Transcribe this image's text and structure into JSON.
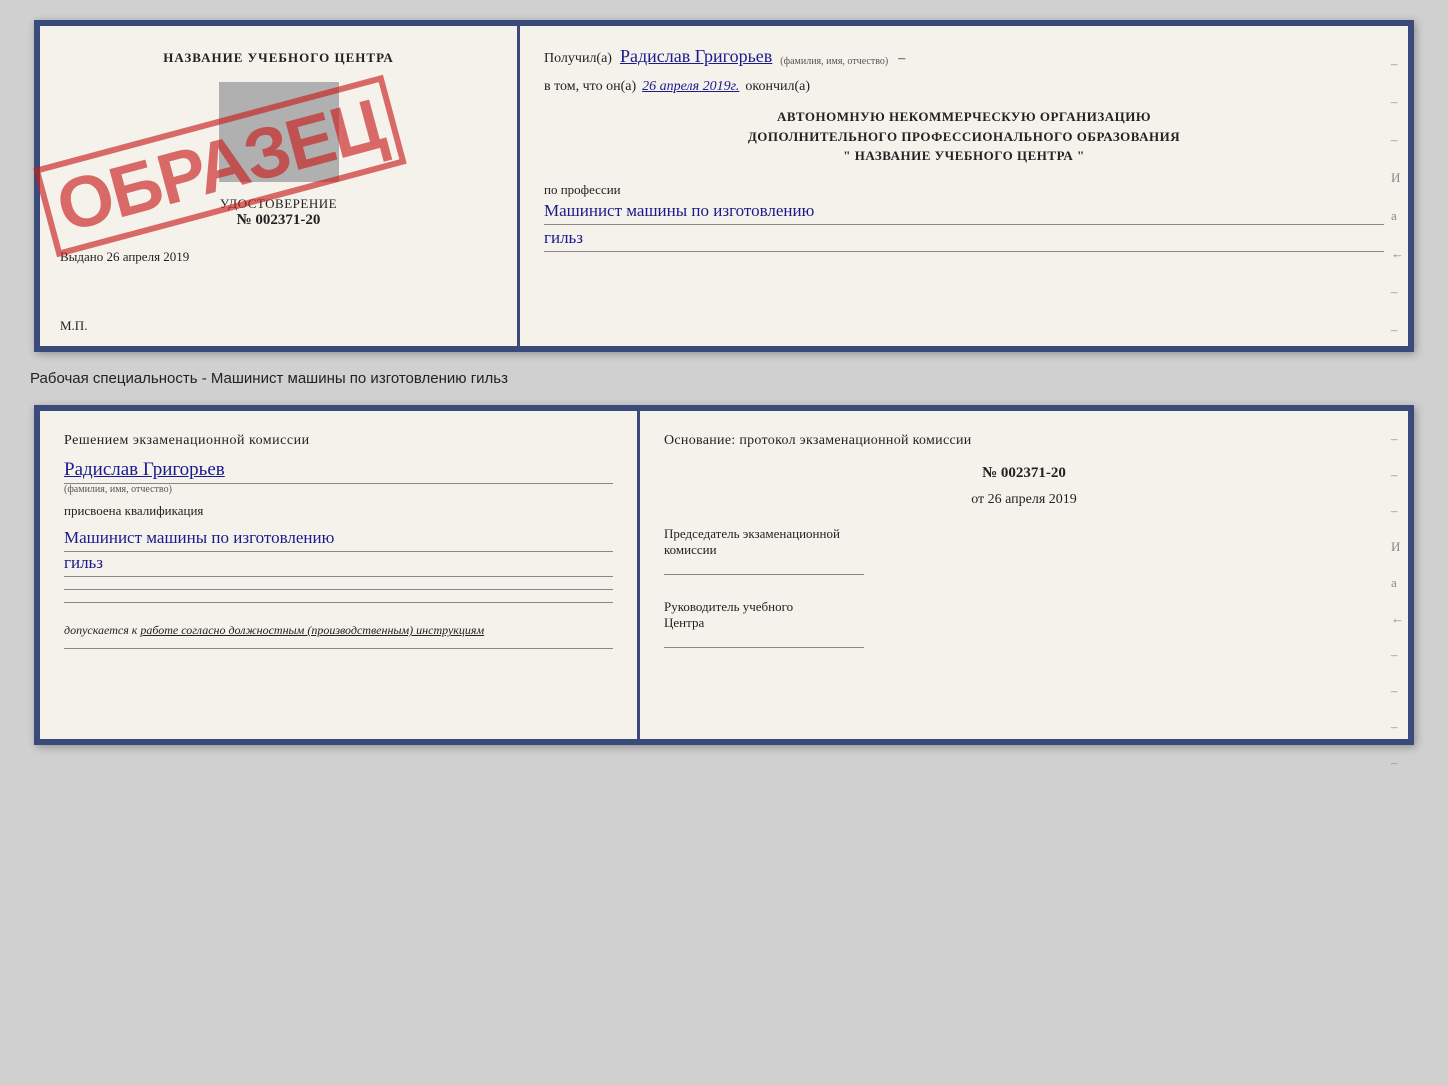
{
  "top_doc": {
    "left": {
      "center_title": "НАЗВАНИЕ УЧЕБНОГО ЦЕНТРА",
      "udostoverenie_label": "УДОСТОВЕРЕНИЕ",
      "number": "№ 002371-20",
      "vydano": "Выдано",
      "vydano_date": "26 апреля 2019",
      "mp": "М.П."
    },
    "stamp": "ОБРАЗЕЦ",
    "right": {
      "poluchil": "Получил(а)",
      "name_handwritten": "Радислав Григорьев",
      "fio_hint": "(фамилия, имя, отчество)",
      "dash": "–",
      "vtom_prefix": "в том, что он(а)",
      "date_handwritten": "26 апреля 2019г.",
      "okonchil": "окончил(а)",
      "org_line1": "АВТОНОМНУЮ НЕКОММЕРЧЕСКУЮ ОРГАНИЗАЦИЮ",
      "org_line2": "ДОПОЛНИТЕЛЬНОГО ПРОФЕССИОНАЛЬНОГО ОБРАЗОВАНИЯ",
      "org_quote_open": "\"",
      "org_name": "НАЗВАНИЕ УЧЕБНОГО ЦЕНТРА",
      "org_quote_close": "\"",
      "po_professii": "по профессии",
      "profession_hand": "Машинист машины по изготовлению",
      "profession_hand2": "гильз",
      "side_dashes": [
        "–",
        "–",
        "–",
        "–",
        "–",
        "–",
        "–",
        "–"
      ]
    }
  },
  "specialty_label": "Рабочая специальность - Машинист машины по изготовлению гильз",
  "bottom_doc": {
    "left": {
      "resheniye": "Решением  экзаменационной  комиссии",
      "name_hand": "Радислав Григорьев",
      "fio_hint": "(фамилия, имя, отчество)",
      "prisvoyena": "присвоена квалификация",
      "qualification_hand": "Машинист машины по изготовлению",
      "qualification_hand2": "гильз",
      "dopuskaetsya_prefix": "допускается к",
      "dopuskaetsya_underline": "работе согласно должностным (производственным) инструкциям"
    },
    "right": {
      "osnovaniye": "Основание: протокол экзаменационной  комиссии",
      "protocol_number": "№  002371-20",
      "ot_prefix": "от",
      "ot_date": "26 апреля 2019",
      "predsedatel_label1": "Председатель экзаменационной",
      "predsedatel_label2": "комиссии",
      "rukovoditel_label1": "Руководитель учебного",
      "rukovoditel_label2": "Центра",
      "side_dashes": [
        "–",
        "–",
        "–",
        "И",
        "а",
        "←",
        "–",
        "–",
        "–",
        "–"
      ]
    }
  }
}
